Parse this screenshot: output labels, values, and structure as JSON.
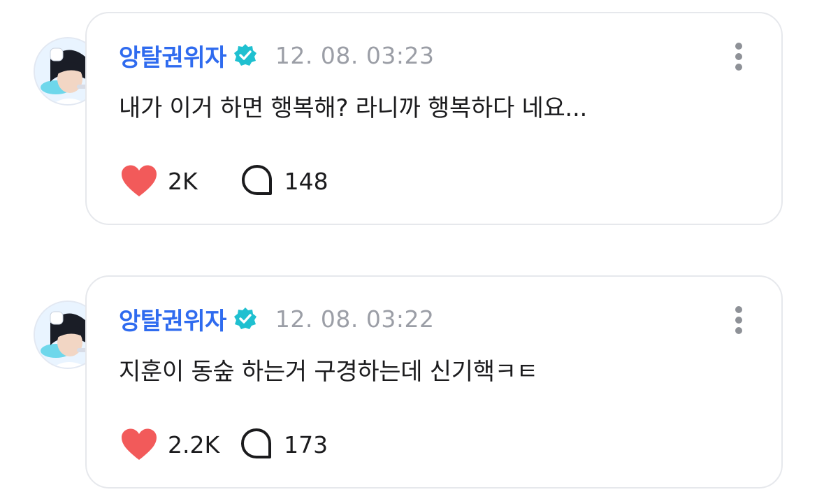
{
  "posts": [
    {
      "author": "앙탈권위자",
      "verified": true,
      "timestamp": "12. 08. 03:23",
      "text": "내가 이거 하면 행복해? 라니까 행복하다 네요...",
      "likes": "2K",
      "comments": "148"
    },
    {
      "author": "앙탈권위자",
      "verified": true,
      "timestamp": "12. 08. 03:22",
      "text": "지훈이 동숲 하는거 구경하는데 신기핵ㅋㅌ",
      "likes": "2.2K",
      "comments": "173"
    }
  ],
  "icons": {
    "verified": "verified-badge-icon",
    "more": "more-vertical-icon",
    "like": "heart-icon",
    "comment": "speech-bubble-icon"
  },
  "colors": {
    "author": "#2f6bef",
    "verified_badge": "#1fc0d0",
    "timestamp": "#9b9ea6",
    "heart": "#f25a5a",
    "card_border": "#e6e8ec"
  }
}
